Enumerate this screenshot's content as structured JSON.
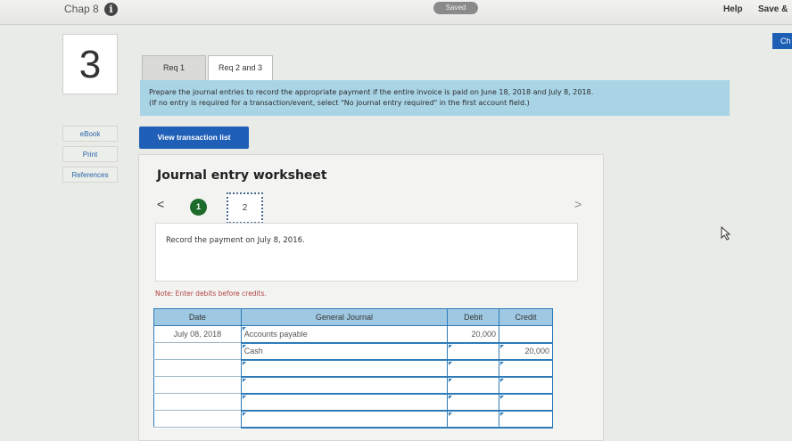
{
  "header": {
    "chapter": "Chap 8",
    "saved": "Saved",
    "help": "Help",
    "save_exit": "Save &",
    "check": "Ch"
  },
  "question": {
    "number": "3"
  },
  "sidebar": {
    "items": [
      {
        "label": "eBook"
      },
      {
        "label": "Print"
      },
      {
        "label": "References"
      }
    ]
  },
  "tabs": [
    {
      "label": "Req 1"
    },
    {
      "label": "Req 2 and 3"
    }
  ],
  "instructions": {
    "line1": "Prepare the journal entries to record the appropriate payment if the entire invoice is paid on June 18, 2018 and July 8, 2018.",
    "line2": "(If no entry is required for a transaction/event, select \"No journal entry required\" in the first account field.)"
  },
  "view_transaction_list": "View transaction list",
  "worksheet": {
    "title": "Journal entry worksheet",
    "prev": "<",
    "next": ">",
    "steps": [
      "1",
      "2"
    ],
    "record_text": "Record the payment on July 8, 2016.",
    "note": "Note: Enter debits before credits."
  },
  "journal": {
    "headers": [
      "Date",
      "General Journal",
      "Debit",
      "Credit"
    ],
    "rows": [
      {
        "date": "July 08, 2018",
        "account": "Accounts payable",
        "debit": "20,000",
        "credit": ""
      },
      {
        "date": "",
        "account": "Cash",
        "debit": "",
        "credit": "20,000"
      },
      {
        "date": "",
        "account": "",
        "debit": "",
        "credit": ""
      },
      {
        "date": "",
        "account": "",
        "debit": "",
        "credit": ""
      },
      {
        "date": "",
        "account": "",
        "debit": "",
        "credit": ""
      },
      {
        "date": "",
        "account": "",
        "debit": "",
        "credit": ""
      }
    ]
  }
}
